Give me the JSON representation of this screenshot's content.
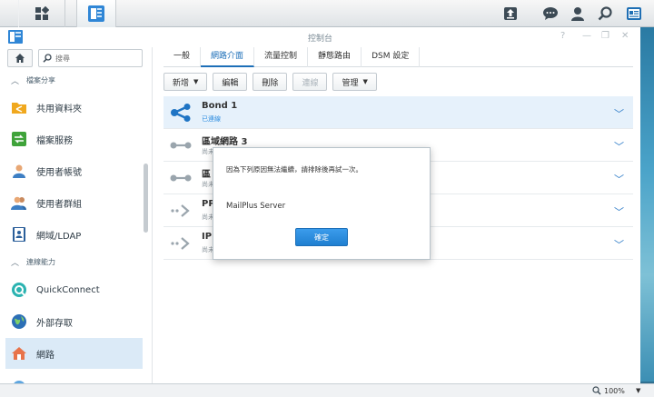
{
  "window": {
    "title": "控制台"
  },
  "sidebar": {
    "search_placeholder": "搜尋",
    "sections": [
      {
        "label": "檔案分享"
      },
      {
        "label": "連線能力"
      }
    ],
    "items": [
      {
        "label": "共用資料夾"
      },
      {
        "label": "檔案服務"
      },
      {
        "label": "使用者帳號"
      },
      {
        "label": "使用者群組"
      },
      {
        "label": "網域/LDAP"
      },
      {
        "label": "QuickConnect"
      },
      {
        "label": "外部存取"
      },
      {
        "label": "網路"
      }
    ]
  },
  "tabs": [
    {
      "label": "一般"
    },
    {
      "label": "網路介面"
    },
    {
      "label": "流量控制"
    },
    {
      "label": "靜態路由"
    },
    {
      "label": "DSM 設定"
    }
  ],
  "toolbar": {
    "create": "新增",
    "edit": "編輯",
    "delete": "刪除",
    "connect": "連線",
    "manage": "管理"
  },
  "interfaces": [
    {
      "name": "Bond 1",
      "status": "已連線"
    },
    {
      "name": "區域網路 3",
      "status": "尚未"
    },
    {
      "name": "區",
      "status": "尚未"
    },
    {
      "name": "PP",
      "status": "尚未"
    },
    {
      "name": "IP",
      "status": "尚未"
    }
  ],
  "dialog": {
    "message": "因為下列原因無法繼續，請排除後再試一次。",
    "item": "MailPlus Server",
    "ok_label": "確定"
  },
  "statusbar": {
    "zoom": "100%"
  },
  "colors": {
    "accent": "#1d6fb8",
    "selected_row": "#e6f1fb",
    "sidebar_active": "#dbeaf7"
  }
}
